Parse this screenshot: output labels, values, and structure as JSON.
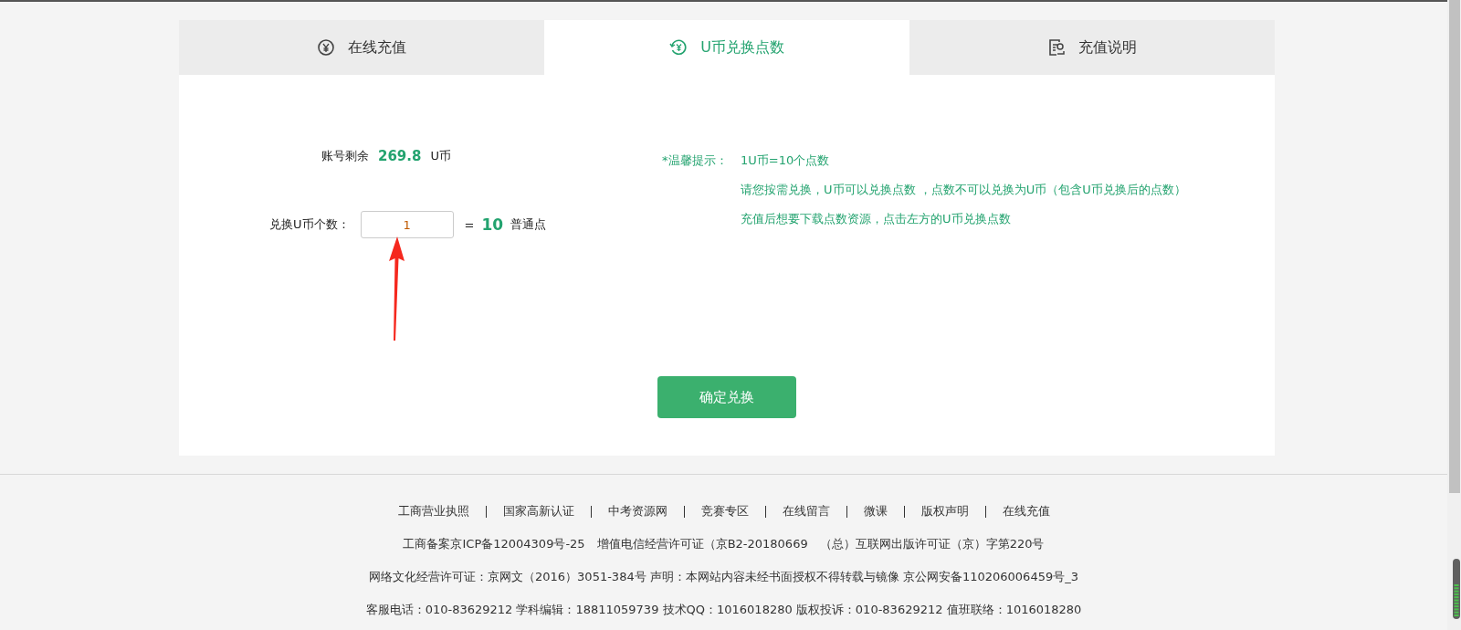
{
  "tabs": [
    {
      "label": "在线充值",
      "selected": false
    },
    {
      "label": "U币兑换点数",
      "selected": true
    },
    {
      "label": "充值说明",
      "selected": false
    }
  ],
  "balance": {
    "label": "账号剩余",
    "value": "269.8",
    "unit": "U币"
  },
  "exchange": {
    "label": "兑换U币个数：",
    "value": "1",
    "equals": "=",
    "result": "10",
    "result_unit": "普通点"
  },
  "tips": {
    "label": "*温馨提示：",
    "lines": [
      "1U币=10个点数",
      "请您按需兑换，U币可以兑换点数 ，点数不可以兑换为U币（包含U币兑换后的点数）",
      "充值后想要下载点数资源，点击左方的U币兑换点数"
    ]
  },
  "confirm_button": "确定兑换",
  "footer": {
    "links": [
      "工商营业执照",
      "国家高新认证",
      "中考资源网",
      "竞赛专区",
      "在线留言",
      "微课",
      "版权声明",
      "在线充值"
    ],
    "lines": [
      "工商备案京ICP备12004309号-25　增值电信经营许可证（京B2-20180669　（总）互联网出版许可证（京）字第220号",
      "网络文化经营许可证：京网文（2016）3051-384号 声明：本网站内容未经书面授权不得转载与镜像 京公网安备110206006459号_3",
      "客服电话：010-83629212 学科编辑：18811059739 技术QQ：1016018280 版权投诉：010-83629212 值班联络：1016018280"
    ]
  }
}
